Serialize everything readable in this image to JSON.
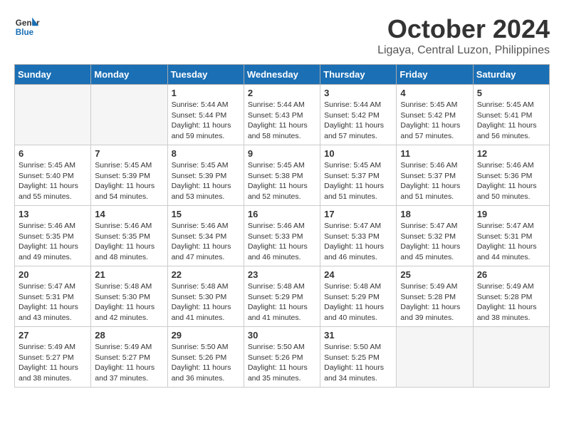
{
  "header": {
    "logo_line1": "General",
    "logo_line2": "Blue",
    "month": "October 2024",
    "location": "Ligaya, Central Luzon, Philippines"
  },
  "days_of_week": [
    "Sunday",
    "Monday",
    "Tuesday",
    "Wednesday",
    "Thursday",
    "Friday",
    "Saturday"
  ],
  "weeks": [
    [
      {
        "day": "",
        "text": ""
      },
      {
        "day": "",
        "text": ""
      },
      {
        "day": "1",
        "text": "Sunrise: 5:44 AM\nSunset: 5:44 PM\nDaylight: 11 hours\nand 59 minutes."
      },
      {
        "day": "2",
        "text": "Sunrise: 5:44 AM\nSunset: 5:43 PM\nDaylight: 11 hours\nand 58 minutes."
      },
      {
        "day": "3",
        "text": "Sunrise: 5:44 AM\nSunset: 5:42 PM\nDaylight: 11 hours\nand 57 minutes."
      },
      {
        "day": "4",
        "text": "Sunrise: 5:45 AM\nSunset: 5:42 PM\nDaylight: 11 hours\nand 57 minutes."
      },
      {
        "day": "5",
        "text": "Sunrise: 5:45 AM\nSunset: 5:41 PM\nDaylight: 11 hours\nand 56 minutes."
      }
    ],
    [
      {
        "day": "6",
        "text": "Sunrise: 5:45 AM\nSunset: 5:40 PM\nDaylight: 11 hours\nand 55 minutes."
      },
      {
        "day": "7",
        "text": "Sunrise: 5:45 AM\nSunset: 5:39 PM\nDaylight: 11 hours\nand 54 minutes."
      },
      {
        "day": "8",
        "text": "Sunrise: 5:45 AM\nSunset: 5:39 PM\nDaylight: 11 hours\nand 53 minutes."
      },
      {
        "day": "9",
        "text": "Sunrise: 5:45 AM\nSunset: 5:38 PM\nDaylight: 11 hours\nand 52 minutes."
      },
      {
        "day": "10",
        "text": "Sunrise: 5:45 AM\nSunset: 5:37 PM\nDaylight: 11 hours\nand 51 minutes."
      },
      {
        "day": "11",
        "text": "Sunrise: 5:46 AM\nSunset: 5:37 PM\nDaylight: 11 hours\nand 51 minutes."
      },
      {
        "day": "12",
        "text": "Sunrise: 5:46 AM\nSunset: 5:36 PM\nDaylight: 11 hours\nand 50 minutes."
      }
    ],
    [
      {
        "day": "13",
        "text": "Sunrise: 5:46 AM\nSunset: 5:35 PM\nDaylight: 11 hours\nand 49 minutes."
      },
      {
        "day": "14",
        "text": "Sunrise: 5:46 AM\nSunset: 5:35 PM\nDaylight: 11 hours\nand 48 minutes."
      },
      {
        "day": "15",
        "text": "Sunrise: 5:46 AM\nSunset: 5:34 PM\nDaylight: 11 hours\nand 47 minutes."
      },
      {
        "day": "16",
        "text": "Sunrise: 5:46 AM\nSunset: 5:33 PM\nDaylight: 11 hours\nand 46 minutes."
      },
      {
        "day": "17",
        "text": "Sunrise: 5:47 AM\nSunset: 5:33 PM\nDaylight: 11 hours\nand 46 minutes."
      },
      {
        "day": "18",
        "text": "Sunrise: 5:47 AM\nSunset: 5:32 PM\nDaylight: 11 hours\nand 45 minutes."
      },
      {
        "day": "19",
        "text": "Sunrise: 5:47 AM\nSunset: 5:31 PM\nDaylight: 11 hours\nand 44 minutes."
      }
    ],
    [
      {
        "day": "20",
        "text": "Sunrise: 5:47 AM\nSunset: 5:31 PM\nDaylight: 11 hours\nand 43 minutes."
      },
      {
        "day": "21",
        "text": "Sunrise: 5:48 AM\nSunset: 5:30 PM\nDaylight: 11 hours\nand 42 minutes."
      },
      {
        "day": "22",
        "text": "Sunrise: 5:48 AM\nSunset: 5:30 PM\nDaylight: 11 hours\nand 41 minutes."
      },
      {
        "day": "23",
        "text": "Sunrise: 5:48 AM\nSunset: 5:29 PM\nDaylight: 11 hours\nand 41 minutes."
      },
      {
        "day": "24",
        "text": "Sunrise: 5:48 AM\nSunset: 5:29 PM\nDaylight: 11 hours\nand 40 minutes."
      },
      {
        "day": "25",
        "text": "Sunrise: 5:49 AM\nSunset: 5:28 PM\nDaylight: 11 hours\nand 39 minutes."
      },
      {
        "day": "26",
        "text": "Sunrise: 5:49 AM\nSunset: 5:28 PM\nDaylight: 11 hours\nand 38 minutes."
      }
    ],
    [
      {
        "day": "27",
        "text": "Sunrise: 5:49 AM\nSunset: 5:27 PM\nDaylight: 11 hours\nand 38 minutes."
      },
      {
        "day": "28",
        "text": "Sunrise: 5:49 AM\nSunset: 5:27 PM\nDaylight: 11 hours\nand 37 minutes."
      },
      {
        "day": "29",
        "text": "Sunrise: 5:50 AM\nSunset: 5:26 PM\nDaylight: 11 hours\nand 36 minutes."
      },
      {
        "day": "30",
        "text": "Sunrise: 5:50 AM\nSunset: 5:26 PM\nDaylight: 11 hours\nand 35 minutes."
      },
      {
        "day": "31",
        "text": "Sunrise: 5:50 AM\nSunset: 5:25 PM\nDaylight: 11 hours\nand 34 minutes."
      },
      {
        "day": "",
        "text": ""
      },
      {
        "day": "",
        "text": ""
      }
    ]
  ]
}
